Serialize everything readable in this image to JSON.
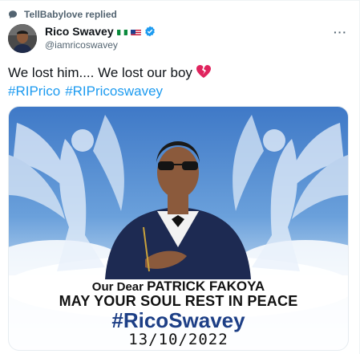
{
  "context": {
    "label": "TellBabylove replied",
    "icon": "chat-bubble-icon"
  },
  "author": {
    "name": "Rico Swavey",
    "handle": "@iamricoswavey",
    "flags": [
      "nigeria-flag",
      "usa-flag"
    ],
    "verified": true,
    "verified_color": "#1d9bf0"
  },
  "more_label": "···",
  "tweet": {
    "text": "We lost him.... We lost our boy",
    "emoji": "broken-heart-icon",
    "hashtags": [
      "#RIPrico",
      "#RIPricoswavey"
    ],
    "link_color": "#1d9bf0"
  },
  "media": {
    "caption_prefix": "Our Dear",
    "caption_name": "PATRICK FAKOYA",
    "caption_line2": "MAY YOUR SOUL REST IN PEACE",
    "caption_tag": "#RicoSwavey",
    "caption_date": "13/10/2022",
    "tag_color": "#1d3f86"
  }
}
